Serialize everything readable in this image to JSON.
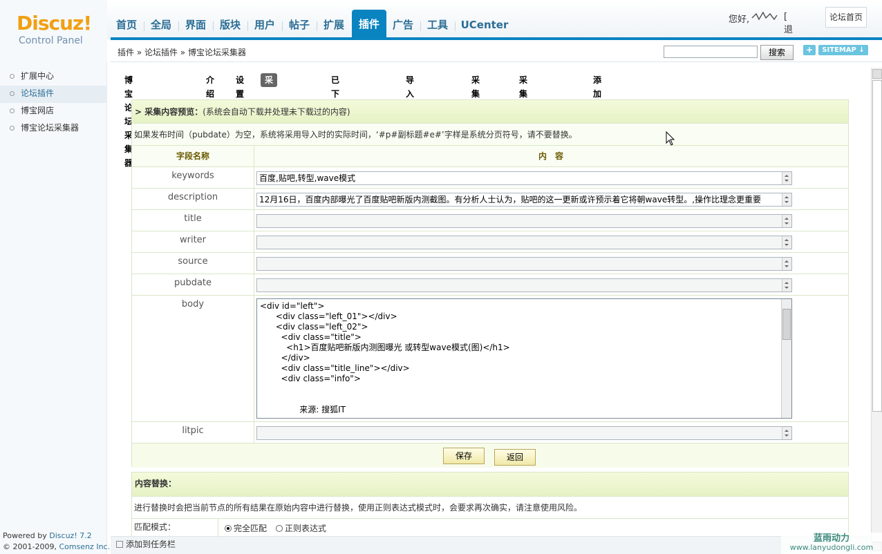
{
  "logo": {
    "brand": "Discuz!",
    "sub": "Control Panel"
  },
  "topnav": {
    "tabs": [
      "首页",
      "全局",
      "界面",
      "版块",
      "用户",
      "帖子",
      "扩展",
      "插件",
      "广告",
      "工具",
      "UCenter"
    ],
    "active": "插件"
  },
  "user": {
    "greeting": "您好,",
    "logout": "[ 退出 ]",
    "forum_home": "论坛首页"
  },
  "breadcrumb": "插件 » 论坛插件 » 博宝论坛采集器",
  "search": {
    "button": "搜索",
    "plus": "+",
    "sitemap": "SITEMAP ↓"
  },
  "sidebar": {
    "items": [
      "扩展中心",
      "论坛插件",
      "博宝网店",
      "博宝论坛采集器"
    ],
    "active": "论坛插件"
  },
  "footer": {
    "powered": "Powered by",
    "product": "Discuz! 7.2",
    "copy": "© 2001-2009,",
    "company": "Comsenz Inc."
  },
  "plugin_nav": {
    "title": "博宝论坛采集器",
    "items": [
      "介绍",
      "设置",
      "采集节点管理",
      "已下载内容管理",
      "导入采集规则",
      "采集监控",
      "采集未下载内容",
      "添加新节点"
    ],
    "active": "采集节点管理"
  },
  "preview": {
    "heading": "> 采集内容预览：",
    "heading_note": "(系统会自动下载并处理未下载过的内容)",
    "notice": "如果发布时间（pubdate）为空，系统将采用导入时的实际时间，‘#p#副标题#e#’字样是系统分页符号，请不要替换。",
    "col_field": "字段名称",
    "col_content": "内　容",
    "fields": [
      {
        "name": "keywords",
        "value": "百度,贴吧,转型,wave模式"
      },
      {
        "name": "description",
        "value": "12月16日，百度内部曝光了百度贴吧新版内测截图。有分析人士认为，贴吧的这一更新或许预示着它将朝wave转型。,操作比理念更重要"
      },
      {
        "name": "title",
        "value": ""
      },
      {
        "name": "writer",
        "value": ""
      },
      {
        "name": "source",
        "value": ""
      },
      {
        "name": "pubdate",
        "value": ""
      }
    ],
    "body_label": "body",
    "body_lines": [
      "<div id=\"left\">",
      "      <div class=\"left_01\"></div>",
      "      <div class=\"left_02\">",
      "        <div class=\"title\">",
      "          <h1>百度贴吧新版内测图曝光 或转型wave模式(图)</h1>",
      "        </div>",
      "        <div class=\"title_line\"></div>",
      "        <div class=\"info\">",
      "",
      "",
      "               来源: 搜狐IT"
    ],
    "litpic_label": "litpic",
    "save": "保存",
    "back": "返回"
  },
  "replace": {
    "heading": "内容替换：",
    "notice": "进行替换时会把当前节点的所有结果在原始内容中进行替换，使用正则表达式模式时，会要求再次确实，请注意使用风险。",
    "mode_label": "匹配模式：",
    "options": [
      "完全匹配",
      "正则表达式"
    ],
    "selected": "完全匹配"
  },
  "taskbar": "添加到任务栏",
  "watermark": {
    "name": "蓝雨动力",
    "url": "www.lanyudongli.com"
  }
}
